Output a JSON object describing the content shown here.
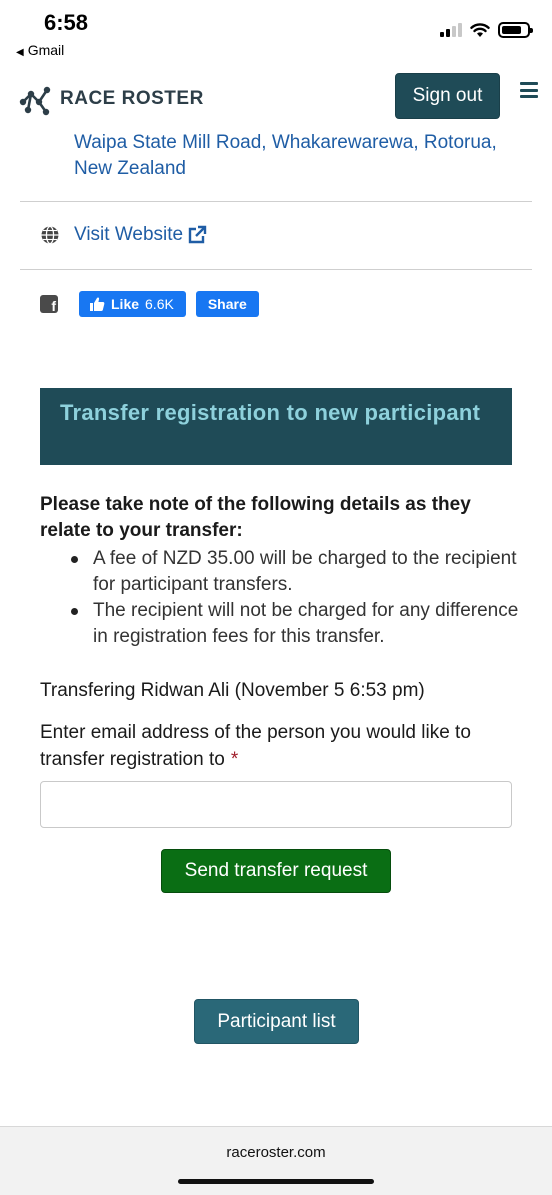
{
  "status_bar": {
    "time": "6:58",
    "back_app": "Gmail"
  },
  "header": {
    "logo_text": "RACE ROSTER",
    "signout_label": "Sign out",
    "menu_icon": "hamburger-icon"
  },
  "event": {
    "address": "Waipa State Mill Road, Whakarewarewa, Rotorua, New Zealand",
    "website_label": "Visit Website",
    "like_label": "Like",
    "like_count": "6.6K",
    "share_label": "Share"
  },
  "transfer": {
    "title": "Transfer registration to new participant",
    "notice_heading": "Please take note of the following details as they relate to your transfer:",
    "notice_items": [
      "A fee of NZD 35.00 will be charged to the recipient for participant transfers.",
      "The recipient will not be charged for any difference in registration fees for this transfer."
    ],
    "transferring_text": "Transfering Ridwan Ali (November 5 6:53 pm)",
    "email_label": "Enter email address of the person you would like to transfer registration to",
    "required_mark": "*",
    "email_value": "",
    "send_label": "Send transfer request"
  },
  "footer": {
    "participant_list_label": "Participant list"
  },
  "browser": {
    "url": "raceroster.com"
  },
  "colors": {
    "brand_dark": "#1f4b57",
    "title_light": "#8ed1dc",
    "link_blue": "#1f5da5",
    "send_green": "#0a6e14",
    "facebook_blue": "#1877f2"
  }
}
